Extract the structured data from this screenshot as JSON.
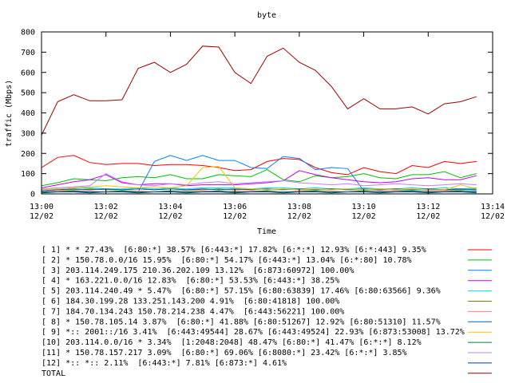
{
  "chart_data": {
    "type": "line",
    "title": "byte",
    "xlabel": "Time",
    "ylabel": "traffic (Mbps)",
    "ylim": [
      0,
      800
    ],
    "yticks": [
      0,
      100,
      200,
      300,
      400,
      500,
      600,
      700,
      800
    ],
    "x_ticks": [
      {
        "t": 0,
        "time": "13:00",
        "date": "12/02"
      },
      {
        "t": 2,
        "time": "13:02",
        "date": "12/02"
      },
      {
        "t": 4,
        "time": "13:04",
        "date": "12/02"
      },
      {
        "t": 6,
        "time": "13:06",
        "date": "12/02"
      },
      {
        "t": 8,
        "time": "13:08",
        "date": "12/02"
      },
      {
        "t": 10,
        "time": "13:10",
        "date": "12/02"
      },
      {
        "t": 12,
        "time": "13:12",
        "date": "12/02"
      },
      {
        "t": 14,
        "time": "13:14",
        "date": "12/02"
      }
    ],
    "x": [
      0.0,
      0.5,
      1.0,
      1.5,
      2.0,
      2.5,
      3.0,
      3.5,
      4.0,
      4.5,
      5.0,
      5.5,
      6.0,
      6.5,
      7.0,
      7.5,
      8.0,
      8.5,
      9.0,
      9.5,
      10.0,
      10.5,
      11.0,
      11.5,
      12.0,
      12.5,
      13.0,
      13.5
    ],
    "grid": false,
    "legend_position": "bottom",
    "series": [
      {
        "name": "[ 1] * * 27.43%  [6:80:*] 38.57% [6:443:*] 17.82% [6:*:*] 12.93% [6:*:443] 9.35%",
        "color": "#ff0000",
        "values": [
          130,
          180,
          190,
          155,
          145,
          150,
          150,
          140,
          145,
          145,
          140,
          130,
          115,
          120,
          160,
          175,
          170,
          130,
          105,
          95,
          130,
          110,
          100,
          140,
          130,
          160,
          150,
          160
        ]
      },
      {
        "name": "[ 2] * 150.78.0.0/16 15.95%  [6:80:*] 54.17% [6:443:*] 13.04% [6:*:80] 10.78%",
        "color": "#00c000",
        "values": [
          40,
          55,
          75,
          70,
          65,
          80,
          85,
          80,
          95,
          75,
          75,
          95,
          90,
          85,
          120,
          70,
          60,
          90,
          80,
          85,
          100,
          80,
          75,
          95,
          95,
          110,
          80,
          100
        ]
      },
      {
        "name": "[ 3] 203.114.249.175 210.36.202.109 13.12%  [6:873:60972] 100.00%",
        "color": "#0080ff",
        "values": [
          10,
          10,
          10,
          10,
          10,
          10,
          10,
          160,
          190,
          165,
          190,
          165,
          165,
          130,
          125,
          185,
          175,
          120,
          130,
          125,
          15,
          15,
          15,
          15,
          15,
          15,
          15,
          15
        ]
      },
      {
        "name": "[ 4] * 163.221.0.0/16 12.83%  [6:80:*] 53.53% [6:443:*] 38.25%",
        "color": "#c000ff",
        "values": [
          30,
          45,
          60,
          70,
          95,
          55,
          45,
          50,
          50,
          40,
          45,
          45,
          45,
          50,
          55,
          65,
          115,
          95,
          80,
          70,
          60,
          55,
          60,
          75,
          80,
          70,
          70,
          90
        ]
      },
      {
        "name": "[ 5] 203.114.240.49 * 5.47%  [6:80:*] 57.15% [6:80:63839] 17.46% [6:80:63566] 9.36%",
        "color": "#00e0e0",
        "values": [
          20,
          25,
          30,
          30,
          25,
          25,
          30,
          25,
          30,
          25,
          30,
          30,
          30,
          25,
          30,
          30,
          25,
          30,
          25,
          25,
          30,
          25,
          25,
          30,
          25,
          30,
          25,
          30
        ]
      },
      {
        "name": "[ 6] 184.30.199.28 133.251.143.200 4.91%  [6:80:41818] 100.00%",
        "color": "#808000",
        "values": [
          15,
          20,
          20,
          25,
          20,
          20,
          25,
          20,
          25,
          20,
          20,
          25,
          20,
          25,
          20,
          25,
          20,
          20,
          25,
          20,
          20,
          25,
          20,
          20,
          25,
          20,
          20,
          25
        ]
      },
      {
        "name": "[ 7] 184.70.134.243 150.78.214.238 4.47%  [6:443:56221] 100.00%",
        "color": "#ff8080",
        "values": [
          10,
          15,
          15,
          15,
          10,
          15,
          15,
          10,
          15,
          15,
          15,
          10,
          15,
          15,
          15,
          10,
          15,
          15,
          15,
          10,
          15,
          15,
          15,
          10,
          15,
          15,
          15,
          10
        ]
      },
      {
        "name": "[ 8] * 150.78.105.14 3.87%  [6:80:*] 41.88% [6:80:51267] 12.92% [6:80:51310] 11.57%",
        "color": "#0060c0",
        "values": [
          15,
          20,
          25,
          20,
          25,
          20,
          25,
          20,
          25,
          20,
          25,
          20,
          25,
          20,
          25,
          20,
          25,
          20,
          25,
          20,
          25,
          20,
          25,
          20,
          25,
          20,
          25,
          20
        ]
      },
      {
        "name": "[ 9] *:: 2001::/16 3.41%  [6:443:49544] 28.67% [6:443:49524] 22.93% [6:873:53008] 13.72%",
        "color": "#ffc000",
        "values": [
          20,
          25,
          30,
          35,
          40,
          35,
          30,
          35,
          30,
          40,
          130,
          135,
          30,
          25,
          20,
          25,
          20,
          25,
          20,
          25,
          20,
          25,
          20,
          25,
          20,
          20,
          45,
          25
        ]
      },
      {
        "name": "[10] 203.114.0.0/16 * 3.34%  [1:2048:2048] 48.47% [6:80:*] 41.47% [6:*:*] 8.12%",
        "color": "#008040",
        "values": [
          10,
          10,
          15,
          10,
          10,
          15,
          10,
          10,
          15,
          10,
          10,
          15,
          10,
          10,
          15,
          10,
          10,
          15,
          10,
          10,
          15,
          10,
          10,
          15,
          10,
          10,
          15,
          10
        ]
      },
      {
        "name": "[11] * 150.78.157.217 3.09%  [6:80:*] 69.06% [6:8080:*] 23.42% [6:*:*] 3.85%",
        "color": "#c080ff",
        "values": [
          25,
          30,
          35,
          40,
          100,
          60,
          45,
          40,
          50,
          45,
          55,
          60,
          50,
          55,
          60,
          65,
          55,
          50,
          45,
          50,
          40,
          45,
          50,
          45,
          40,
          45,
          50,
          45
        ]
      },
      {
        "name": "[12] *:: *:: 2.11%  [6:443:*] 7.81% [6:873:*] 4.61%",
        "color": "#004080",
        "values": [
          5,
          10,
          10,
          5,
          10,
          10,
          5,
          10,
          10,
          5,
          10,
          10,
          5,
          10,
          10,
          5,
          10,
          10,
          5,
          10,
          10,
          5,
          10,
          10,
          5,
          10,
          10,
          5
        ]
      },
      {
        "name": "TOTAL",
        "color": "#a00000",
        "values": [
          290,
          455,
          490,
          460,
          460,
          465,
          620,
          650,
          600,
          640,
          730,
          725,
          600,
          545,
          680,
          720,
          650,
          610,
          530,
          420,
          470,
          420,
          420,
          430,
          395,
          445,
          455,
          480
        ]
      }
    ]
  }
}
